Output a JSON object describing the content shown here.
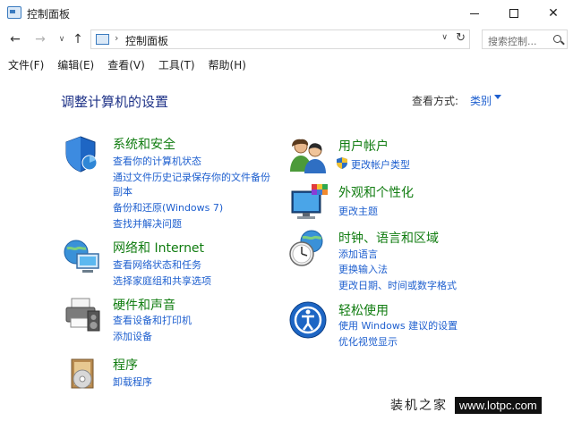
{
  "window": {
    "title": "控制面板"
  },
  "address": {
    "path": "控制面板",
    "search_placeholder": "搜索控制..."
  },
  "menu": [
    "文件(F)",
    "编辑(E)",
    "查看(V)",
    "工具(T)",
    "帮助(H)"
  ],
  "main": {
    "title": "调整计算机的设置",
    "view_by_label": "查看方式:",
    "view_by_value": "类别"
  },
  "categories_left": [
    {
      "title": "系统和安全",
      "icon": "shield-icon",
      "links": [
        "查看你的计算机状态",
        "通过文件历史记录保存你的文件备份",
        "副本",
        "备份和还原(Windows 7)",
        "查找并解决问题"
      ]
    },
    {
      "title": "网络和 Internet",
      "icon": "network-globe-icon",
      "links": [
        "查看网络状态和任务",
        "选择家庭组和共享选项"
      ]
    },
    {
      "title": "硬件和声音",
      "icon": "printer-icon",
      "links": [
        "查看设备和打印机",
        "添加设备"
      ]
    },
    {
      "title": "程序",
      "icon": "programs-icon",
      "links": [
        "卸载程序"
      ]
    }
  ],
  "categories_right": [
    {
      "title": "用户帐户",
      "icon": "users-icon",
      "links": [
        "更改帐户类型"
      ]
    },
    {
      "title": "外观和个性化",
      "icon": "display-palette-icon",
      "links": [
        "更改主题"
      ]
    },
    {
      "title": "时钟、语言和区域",
      "icon": "clock-globe-icon",
      "links": [
        "添加语言",
        "更换输入法",
        "更改日期、时间或数字格式"
      ]
    },
    {
      "title": "轻松使用",
      "icon": "ease-of-access-icon",
      "links": [
        "使用 Windows 建议的设置",
        "优化视觉显示"
      ]
    }
  ],
  "watermark": {
    "cn": "装机之家",
    "url": "www.lotpc.com"
  },
  "colors": {
    "category_title": "#107c10",
    "link": "#1e5fcf",
    "page_title": "#1e3287"
  }
}
